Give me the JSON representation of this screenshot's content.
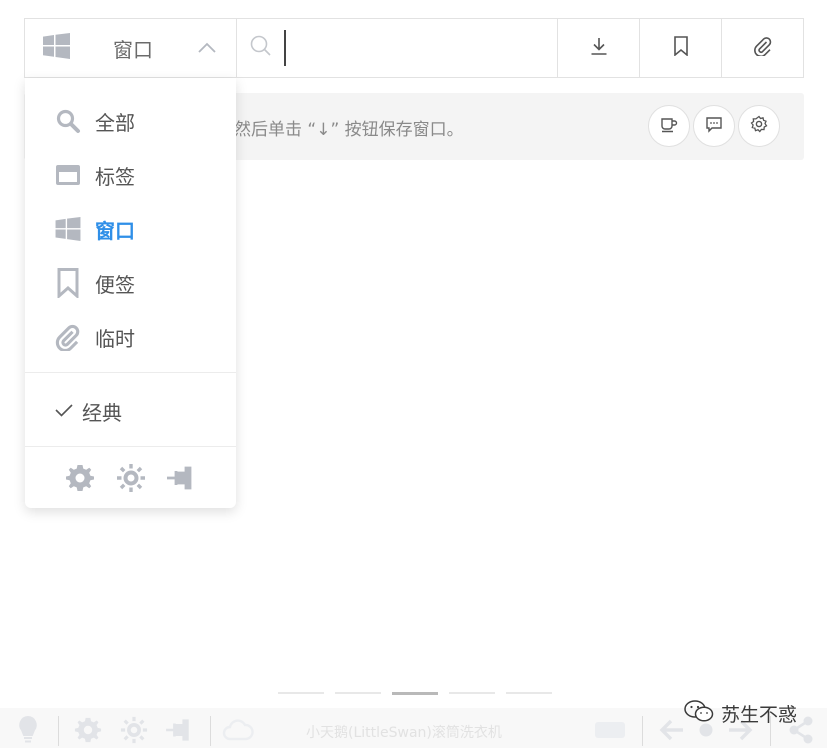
{
  "toolbar": {
    "scope_label": "窗口",
    "search_value": "",
    "icons": {
      "scope": "windows-logo-icon",
      "expand": "chevron-up-icon",
      "search": "search-icon",
      "download": "download-icon",
      "bookmark": "bookmark-icon",
      "attach": "paperclip-icon"
    }
  },
  "tip": {
    "text": "然后单击 “↓” 按钮保存窗口。",
    "buttons": [
      "coffee-icon",
      "message-icon",
      "settings-icon"
    ]
  },
  "dropdown": {
    "items": [
      {
        "label": "全部",
        "icon": "search-icon",
        "active": false
      },
      {
        "label": "标签",
        "icon": "tab-icon",
        "active": false
      },
      {
        "label": "窗口",
        "icon": "windows-logo-icon",
        "active": true
      },
      {
        "label": "便签",
        "icon": "bookmark-icon",
        "active": false
      },
      {
        "label": "临时",
        "icon": "paperclip-icon",
        "active": false
      }
    ],
    "classic_label": "经典",
    "classic_checked": true,
    "footer_icons": [
      "gear-icon",
      "sun-icon",
      "pin-icon"
    ]
  },
  "pager": {
    "count": 5,
    "active_index": 2
  },
  "bottom": {
    "faded_text": "小天鹅(LittleSwan)滚筒洗衣机",
    "watermark": "苏生不惑"
  },
  "colors": {
    "accent": "#2f8fe8",
    "icon_gray": "#b4b8c0",
    "border": "#e2e2e2",
    "banner_bg": "#f4f4f4"
  }
}
